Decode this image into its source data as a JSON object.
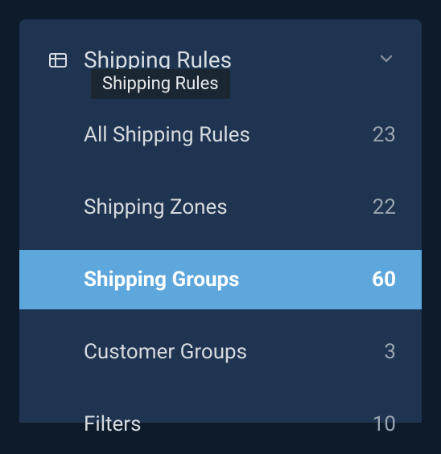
{
  "section": {
    "title": "Shipping Rules",
    "tooltip": "Shipping Rules"
  },
  "nav": {
    "items": [
      {
        "label": "All Shipping Rules",
        "count": "23",
        "active": false
      },
      {
        "label": "Shipping Zones",
        "count": "22",
        "active": false
      },
      {
        "label": "Shipping Groups",
        "count": "60",
        "active": true
      },
      {
        "label": "Customer Groups",
        "count": "3",
        "active": false
      },
      {
        "label": "Filters",
        "count": "10",
        "active": false
      }
    ]
  }
}
